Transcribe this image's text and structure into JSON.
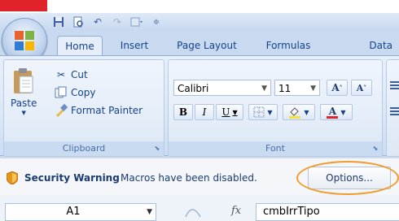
{
  "quick_access": {
    "items": [
      {
        "icon": "save-icon"
      },
      {
        "icon": "print-preview-icon"
      },
      {
        "icon": "undo-icon"
      },
      {
        "icon": "redo-icon"
      },
      {
        "icon": "customize-icon"
      },
      {
        "icon": "more-icon"
      }
    ]
  },
  "tabs": [
    {
      "label": "Home"
    },
    {
      "label": "Insert"
    },
    {
      "label": "Page Layout"
    },
    {
      "label": "Formulas"
    },
    {
      "label": "Data"
    }
  ],
  "ribbon": {
    "clipboard": {
      "label": "Clipboard",
      "paste": "Paste",
      "cut": "Cut",
      "copy": "Copy",
      "format_painter": "Format Painter"
    },
    "font": {
      "label": "Font",
      "font_name": "Calibri",
      "font_size": "11",
      "bold": "B",
      "italic": "I",
      "underline": "U",
      "grow": "A",
      "shrink": "A"
    }
  },
  "security": {
    "title": "Security Warning",
    "message": "Macros have been disabled.",
    "options_label": "Options..."
  },
  "formula_bar": {
    "name_box": "A1",
    "fx": "fx",
    "formula": "cmbIrrTipo"
  },
  "colors": {
    "highlight_circle": "#f19b29",
    "ribbon_text": "#15428b",
    "title_stripe": "#e0222b"
  }
}
